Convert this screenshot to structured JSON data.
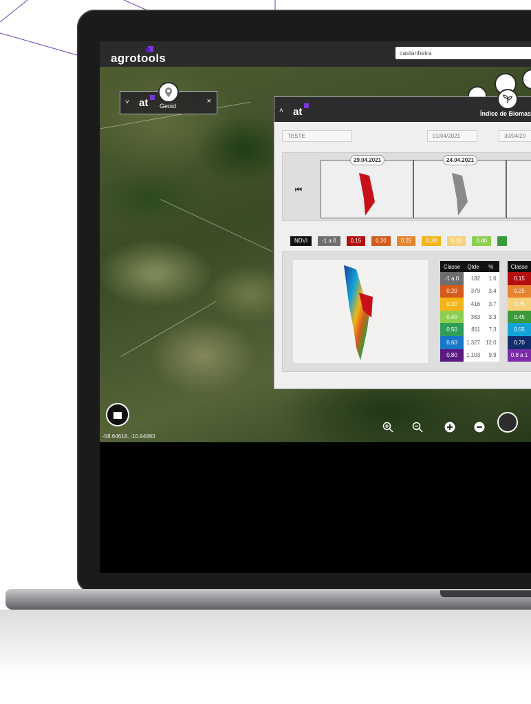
{
  "app": {
    "logo": "agrotools",
    "search_value": "castanheira"
  },
  "geoid_widget": {
    "logo": "at",
    "label": "Geoid",
    "close": "×",
    "collapse": "˅"
  },
  "panel": {
    "logo": "at",
    "collapse": "˄",
    "title": "Índice de Biomas",
    "name_field": "TESTE",
    "date_start": "01/04/2021",
    "date_end": "30/04/20",
    "timeline_dates": [
      "29.04.2021",
      "24.04.2021"
    ],
    "rewind_icon": "rewind-icon"
  },
  "legend": {
    "label": "NDVI",
    "items": [
      {
        "text": "-1 a 0",
        "color": "#6e6e6e"
      },
      {
        "text": "0.15",
        "color": "#b30f0f"
      },
      {
        "text": "0.20",
        "color": "#d35b1b"
      },
      {
        "text": "0.25",
        "color": "#e6852f"
      },
      {
        "text": "0.30",
        "color": "#f3b517"
      },
      {
        "text": "0.35",
        "color": "#f7d27a"
      },
      {
        "text": "0.40",
        "color": "#8ccf4f"
      },
      {
        "text": "",
        "color": "#3b9a3b"
      }
    ]
  },
  "stats_table": {
    "headers": [
      "Classe",
      "Qtde",
      "%"
    ],
    "rows": [
      {
        "classe": "-1 a 0",
        "qtde": "182",
        "pct": "1.6",
        "color": "#6e6e6e"
      },
      {
        "classe": "0.20",
        "qtde": "379",
        "pct": "3.4",
        "color": "#d35b1b"
      },
      {
        "classe": "0.30",
        "qtde": "416",
        "pct": "3.7",
        "color": "#f3b517"
      },
      {
        "classe": "0.40",
        "qtde": "363",
        "pct": "3.3",
        "color": "#8ccf4f"
      },
      {
        "classe": "0.50",
        "qtde": "811",
        "pct": "7.3",
        "color": "#2f9e5a"
      },
      {
        "classe": "0.60",
        "qtde": "1.327",
        "pct": "12.0",
        "color": "#1877c9"
      },
      {
        "classe": "0.80",
        "qtde": "1.103",
        "pct": "9.9",
        "color": "#5b1a82"
      }
    ],
    "second_header": "Classe",
    "second_rows": [
      {
        "classe": "0.15",
        "color": "#b30f0f"
      },
      {
        "classe": "0.25",
        "color": "#e6852f"
      },
      {
        "classe": "0.35",
        "color": "#f7d27a"
      },
      {
        "classe": "0.45",
        "color": "#3b9a3b"
      },
      {
        "classe": "0.55",
        "color": "#14a3d8"
      },
      {
        "classe": "0.70",
        "color": "#0f2e6b"
      },
      {
        "classe": "0.8 a 1",
        "color": "#7a2ca8"
      }
    ]
  },
  "map": {
    "coordinates": "-58.64618, -10.94993",
    "controls": [
      "zoom-in-icon",
      "zoom-out-icon",
      "plus-icon",
      "minus-icon"
    ]
  },
  "colors": {
    "brand_purple": "#7a38d8",
    "topbar": "#2b2b2b"
  }
}
